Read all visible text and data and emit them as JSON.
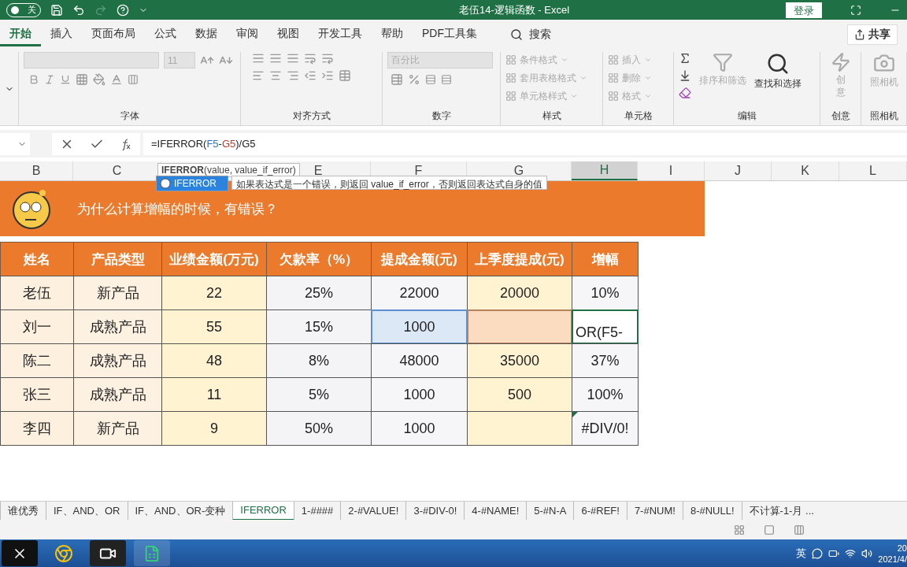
{
  "title_bar": {
    "autosave_label": "关",
    "autosave_on": false,
    "title": "老伍14-逻辑函数 - Excel",
    "login": "登录"
  },
  "menu_tabs": [
    {
      "label": "开始",
      "selected": true
    },
    {
      "label": "插入",
      "selected": false
    },
    {
      "label": "页面布局",
      "selected": false
    },
    {
      "label": "公式",
      "selected": false
    },
    {
      "label": "数据",
      "selected": false
    },
    {
      "label": "审阅",
      "selected": false
    },
    {
      "label": "视图",
      "selected": false
    },
    {
      "label": "开发工具",
      "selected": false
    },
    {
      "label": "帮助",
      "selected": false
    },
    {
      "label": "PDF工具集",
      "selected": false
    }
  ],
  "search": "搜索",
  "share": "共享",
  "ribbon": [
    {
      "kind": "font",
      "label": "字体",
      "font_size": "11"
    },
    {
      "kind": "alignment",
      "label": "对齐方式"
    },
    {
      "kind": "number",
      "label": "数字",
      "format": "百分比"
    },
    {
      "kind": "list",
      "label": "样式",
      "items": [
        {
          "label": "条件格式",
          "disabled": true
        },
        {
          "label": "套用表格格式",
          "disabled": true
        },
        {
          "label": "单元格样式",
          "disabled": true
        }
      ]
    },
    {
      "kind": "list",
      "label": "单元格",
      "items": [
        {
          "label": "插入",
          "disabled": true
        },
        {
          "label": "删除",
          "disabled": true
        },
        {
          "label": "格式",
          "disabled": true
        }
      ]
    },
    {
      "kind": "editing",
      "label": "编辑",
      "sort": {
        "label": "排序和筛选",
        "disabled": true
      },
      "find": {
        "label": "查找和选择",
        "disabled": false
      }
    },
    {
      "kind": "idea",
      "label": "创意",
      "button": {
        "label": "创意",
        "disabled": true
      }
    },
    {
      "kind": "camera",
      "label": "照相机",
      "button": {
        "label": "照相机",
        "disabled": true
      }
    }
  ],
  "formula_bar": {
    "parts": [
      {
        "text": "=IFERROR("
      },
      {
        "text": "F5",
        "color": "#2e6fd0"
      },
      {
        "text": "-"
      },
      {
        "text": "G5",
        "color": "#c0392b"
      },
      {
        "text": ")/G5"
      }
    ]
  },
  "column_headers": [
    {
      "label": "B",
      "selected": false
    },
    {
      "label": "C",
      "selected": false
    },
    {
      "selected": false
    },
    {
      "label": "E",
      "selected": false
    },
    {
      "label": "F",
      "selected": false
    },
    {
      "label": "G",
      "selected": false
    },
    {
      "label": "H",
      "selected": true
    },
    {
      "label": "I",
      "selected": false
    },
    {
      "label": "J",
      "selected": false
    },
    {
      "label": "K",
      "selected": false
    },
    {
      "label": "L",
      "selected": false
    }
  ],
  "function_tip": {
    "signature": "**IFERROR**(value, value_if_error)",
    "suggestion": "IFERROR",
    "description": "如果表达式是一个错误，则返回 value_if_error，否则返回表达式自身的值"
  },
  "banner": {
    "text": "为什么计算增幅的时候，有错误？"
  },
  "table": {
    "columns": [
      "姓名",
      "产品类型",
      "业绩金额(万元)",
      "欠款率（%）",
      "提成金额(元)",
      "上季度提成(元)",
      "增幅"
    ],
    "rows": [
      {
        "cells": [
          {
            "text": "老伍",
            "kind": "plain"
          },
          {
            "text": "新产品",
            "kind": "plain"
          },
          {
            "text": "22",
            "kind": "plain"
          },
          {
            "text": "25%",
            "kind": "plain"
          },
          {
            "text": "22000",
            "kind": "plain"
          },
          {
            "text": "20000",
            "kind": "plain"
          },
          {
            "text": "10%",
            "kind": "plain"
          }
        ]
      },
      {
        "cells": [
          {
            "text": "刘一",
            "kind": "plain"
          },
          {
            "text": "成熟产品",
            "kind": "plain"
          },
          {
            "text": "55",
            "kind": "plain"
          },
          {
            "text": "15%",
            "kind": "plain"
          },
          {
            "text": "1000",
            "kind": "reference"
          },
          {
            "kind": "reference2"
          },
          {
            "text": "OR(F5-",
            "kind": "editing"
          }
        ]
      },
      {
        "cells": [
          {
            "text": "陈二",
            "kind": "plain"
          },
          {
            "text": "成熟产品",
            "kind": "plain"
          },
          {
            "text": "48",
            "kind": "plain"
          },
          {
            "text": "8%",
            "kind": "plain"
          },
          {
            "text": "48000",
            "kind": "plain"
          },
          {
            "text": "35000",
            "kind": "plain"
          },
          {
            "text": "37%",
            "kind": "plain"
          }
        ]
      },
      {
        "cells": [
          {
            "text": "张三",
            "kind": "plain"
          },
          {
            "text": "成熟产品",
            "kind": "plain"
          },
          {
            "text": "11",
            "kind": "plain"
          },
          {
            "text": "5%",
            "kind": "plain"
          },
          {
            "text": "1000",
            "kind": "plain"
          },
          {
            "text": "500",
            "kind": "plain"
          },
          {
            "text": "100%",
            "kind": "plain"
          }
        ]
      },
      {
        "cells": [
          {
            "text": "李四",
            "kind": "plain"
          },
          {
            "text": "新产品",
            "kind": "plain"
          },
          {
            "text": "9",
            "kind": "plain"
          },
          {
            "text": "50%",
            "kind": "plain"
          },
          {
            "text": "1000",
            "kind": "plain"
          },
          {
            "kind": "plain"
          },
          {
            "text": "#DIV/0!",
            "kind": "error"
          }
        ]
      }
    ]
  },
  "sheet_tabs": [
    {
      "label": "谁优秀",
      "selected": false
    },
    {
      "label": "IF、AND、OR",
      "selected": false
    },
    {
      "label": "IF、AND、OR-变种",
      "selected": false
    },
    {
      "label": "IFERROR",
      "selected": true
    },
    {
      "label": "1-####",
      "selected": false
    },
    {
      "label": "2-#VALUE!",
      "selected": false
    },
    {
      "label": "3-#DIV-0!",
      "selected": false
    },
    {
      "label": "4-#NAME!",
      "selected": false
    },
    {
      "label": "5-#N-A",
      "selected": false
    },
    {
      "label": "6-#REF!",
      "selected": false
    },
    {
      "label": "7-#NUM!",
      "selected": false
    },
    {
      "label": "8-#NULL!",
      "selected": false
    },
    {
      "label": "不计算-1-月 ...",
      "selected": false
    }
  ],
  "taskbar": {
    "input_method": "英",
    "time": "20",
    "date": "2021/4/"
  }
}
